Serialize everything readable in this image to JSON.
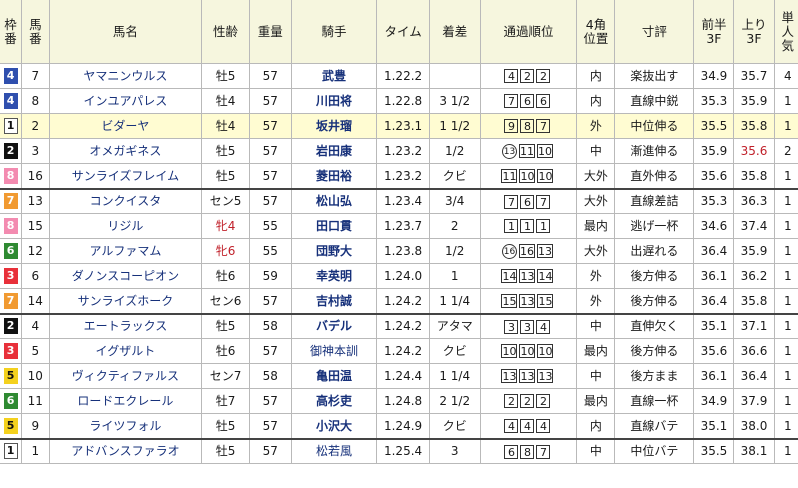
{
  "header": {
    "waku": [
      "枠",
      "番"
    ],
    "umaban": [
      "馬",
      "番"
    ],
    "name": "馬名",
    "sex_age": "性齢",
    "weight": "重量",
    "jockey": "騎手",
    "time": "タイム",
    "margin": "着差",
    "passing": "通過順位",
    "corner": [
      "4角",
      "位置"
    ],
    "comment": "寸評",
    "first3f": [
      "前半",
      "3F"
    ],
    "last3f": [
      "上り",
      "3F"
    ],
    "odds": [
      "単",
      "人",
      "気"
    ]
  },
  "rows": [
    {
      "waku": "4",
      "umaban": "7",
      "name": "ヤマニンウルス",
      "sex_age": "牡5",
      "weight": "57",
      "jockey": "武豊",
      "time": "1.22.2",
      "margin": "",
      "passing": [
        {
          "v": "4",
          "c": false
        },
        {
          "v": "2",
          "c": false
        },
        {
          "v": "2",
          "c": false
        }
      ],
      "corner": "内",
      "comment": "楽抜出す",
      "first3f": "34.9",
      "last3f": "35.7",
      "odds": "4"
    },
    {
      "waku": "4",
      "umaban": "8",
      "name": "インユアパレス",
      "sex_age": "牡4",
      "weight": "57",
      "jockey": "川田将",
      "time": "1.22.8",
      "margin": "3 1/2",
      "passing": [
        {
          "v": "7",
          "c": false
        },
        {
          "v": "6",
          "c": false
        },
        {
          "v": "6",
          "c": false
        }
      ],
      "corner": "内",
      "comment": "直線中鋭",
      "first3f": "35.3",
      "last3f": "35.9",
      "odds": "1"
    },
    {
      "waku": "1",
      "umaban": "2",
      "name": "ビダーヤ",
      "sex_age": "牡4",
      "weight": "57",
      "jockey": "坂井瑠",
      "time": "1.23.1",
      "margin": "1 1/2",
      "passing": [
        {
          "v": "9",
          "c": false
        },
        {
          "v": "8",
          "c": false
        },
        {
          "v": "7",
          "c": false
        }
      ],
      "corner": "外",
      "comment": "中位伸る",
      "first3f": "35.5",
      "last3f": "35.8",
      "odds": "1"
    },
    {
      "waku": "2",
      "umaban": "3",
      "name": "オメガギネス",
      "sex_age": "牡5",
      "weight": "57",
      "jockey": "岩田康",
      "time": "1.23.2",
      "margin": "1/2",
      "passing": [
        {
          "v": "13",
          "c": true
        },
        {
          "v": "11",
          "c": false
        },
        {
          "v": "10",
          "c": false
        }
      ],
      "corner": "中",
      "comment": "漸進伸る",
      "first3f": "35.9",
      "last3f": "35.6",
      "odds": "2"
    },
    {
      "waku": "8",
      "umaban": "16",
      "name": "サンライズフレイム",
      "sex_age": "牡5",
      "weight": "57",
      "jockey": "菱田裕",
      "time": "1.23.2",
      "margin": "クビ",
      "passing": [
        {
          "v": "11",
          "c": false
        },
        {
          "v": "10",
          "c": false
        },
        {
          "v": "10",
          "c": false
        }
      ],
      "corner": "大外",
      "comment": "直外伸る",
      "first3f": "35.6",
      "last3f": "35.8",
      "odds": "1"
    },
    {
      "waku": "7",
      "umaban": "13",
      "name": "コンクイスタ",
      "sex_age": "セン5",
      "weight": "57",
      "jockey": "松山弘",
      "time": "1.23.4",
      "margin": "3/4",
      "passing": [
        {
          "v": "7",
          "c": false
        },
        {
          "v": "6",
          "c": false
        },
        {
          "v": "7",
          "c": false
        }
      ],
      "corner": "大外",
      "comment": "直線差詰",
      "first3f": "35.3",
      "last3f": "36.3",
      "odds": "1"
    },
    {
      "waku": "8",
      "umaban": "15",
      "name": "リジル",
      "sex_age": "牝4",
      "weight": "55",
      "jockey": "田口貫",
      "time": "1.23.7",
      "margin": "2",
      "passing": [
        {
          "v": "1",
          "c": false
        },
        {
          "v": "1",
          "c": false
        },
        {
          "v": "1",
          "c": false
        }
      ],
      "corner": "最内",
      "comment": "逃げ一杯",
      "first3f": "34.6",
      "last3f": "37.4",
      "odds": "1"
    },
    {
      "waku": "6",
      "umaban": "12",
      "name": "アルファマム",
      "sex_age": "牝6",
      "weight": "55",
      "jockey": "団野大",
      "time": "1.23.8",
      "margin": "1/2",
      "passing": [
        {
          "v": "16",
          "c": true
        },
        {
          "v": "16",
          "c": false
        },
        {
          "v": "13",
          "c": false
        }
      ],
      "corner": "大外",
      "comment": "出遅れる",
      "first3f": "36.4",
      "last3f": "35.9",
      "odds": "1"
    },
    {
      "waku": "3",
      "umaban": "6",
      "name": "ダノンスコーピオン",
      "sex_age": "牡6",
      "weight": "59",
      "jockey": "幸英明",
      "time": "1.24.0",
      "margin": "1",
      "passing": [
        {
          "v": "14",
          "c": false
        },
        {
          "v": "13",
          "c": false
        },
        {
          "v": "14",
          "c": false
        }
      ],
      "corner": "外",
      "comment": "後方伸る",
      "first3f": "36.1",
      "last3f": "36.2",
      "odds": "1"
    },
    {
      "waku": "7",
      "umaban": "14",
      "name": "サンライズホーク",
      "sex_age": "セン6",
      "weight": "57",
      "jockey": "吉村誠",
      "time": "1.24.2",
      "margin": "1 1/4",
      "passing": [
        {
          "v": "15",
          "c": false
        },
        {
          "v": "13",
          "c": false
        },
        {
          "v": "15",
          "c": false
        }
      ],
      "corner": "外",
      "comment": "後方伸る",
      "first3f": "36.4",
      "last3f": "35.8",
      "odds": "1"
    },
    {
      "waku": "2",
      "umaban": "4",
      "name": "エートラックス",
      "sex_age": "牡5",
      "weight": "58",
      "jockey": "バデル",
      "time": "1.24.2",
      "margin": "アタマ",
      "passing": [
        {
          "v": "3",
          "c": false
        },
        {
          "v": "3",
          "c": false
        },
        {
          "v": "4",
          "c": false
        }
      ],
      "corner": "中",
      "comment": "直伸欠く",
      "first3f": "35.1",
      "last3f": "37.1",
      "odds": "1"
    },
    {
      "waku": "3",
      "umaban": "5",
      "name": "イグザルト",
      "sex_age": "牡6",
      "weight": "57",
      "jockey": "御神本訓",
      "time": "1.24.2",
      "margin": "クビ",
      "passing": [
        {
          "v": "10",
          "c": false
        },
        {
          "v": "10",
          "c": false
        },
        {
          "v": "10",
          "c": false
        }
      ],
      "corner": "最内",
      "comment": "後方伸る",
      "first3f": "35.6",
      "last3f": "36.6",
      "odds": "1"
    },
    {
      "waku": "5",
      "umaban": "10",
      "name": "ヴィクティファルス",
      "sex_age": "セン7",
      "weight": "58",
      "jockey": "亀田温",
      "time": "1.24.4",
      "margin": "1 1/4",
      "passing": [
        {
          "v": "13",
          "c": false
        },
        {
          "v": "13",
          "c": false
        },
        {
          "v": "13",
          "c": false
        }
      ],
      "corner": "中",
      "comment": "後方まま",
      "first3f": "36.1",
      "last3f": "36.4",
      "odds": "1"
    },
    {
      "waku": "6",
      "umaban": "11",
      "name": "ロードエクレール",
      "sex_age": "牡7",
      "weight": "57",
      "jockey": "高杉吏",
      "time": "1.24.8",
      "margin": "2 1/2",
      "passing": [
        {
          "v": "2",
          "c": false
        },
        {
          "v": "2",
          "c": false
        },
        {
          "v": "2",
          "c": false
        }
      ],
      "corner": "最内",
      "comment": "直線一杯",
      "first3f": "34.9",
      "last3f": "37.9",
      "odds": "1"
    },
    {
      "waku": "5",
      "umaban": "9",
      "name": "ライツフォル",
      "sex_age": "牡5",
      "weight": "57",
      "jockey": "小沢大",
      "time": "1.24.9",
      "margin": "クビ",
      "passing": [
        {
          "v": "4",
          "c": false
        },
        {
          "v": "4",
          "c": false
        },
        {
          "v": "4",
          "c": false
        }
      ],
      "corner": "内",
      "comment": "直線バテ",
      "first3f": "35.1",
      "last3f": "38.0",
      "odds": "1"
    },
    {
      "waku": "1",
      "umaban": "1",
      "name": "アドバンスファラオ",
      "sex_age": "牡5",
      "weight": "57",
      "jockey": "松若風",
      "time": "1.25.4",
      "margin": "3",
      "passing": [
        {
          "v": "6",
          "c": false
        },
        {
          "v": "8",
          "c": false
        },
        {
          "v": "7",
          "c": false
        }
      ],
      "corner": "中",
      "comment": "中位バテ",
      "first3f": "35.5",
      "last3f": "38.1",
      "odds": "1"
    }
  ],
  "highlight_row": 2,
  "group_separators_after": [
    4,
    9,
    14
  ],
  "bold_jockeys": [
    0,
    1,
    2,
    3,
    4,
    5,
    6,
    7,
    8,
    9,
    10,
    12,
    13,
    14
  ],
  "fillies": [
    6,
    7
  ],
  "red_last3f": [
    3
  ],
  "colors": {
    "header_bg": "#f6f6de",
    "highlight_row_bg": "#fffcd2",
    "waku": {
      "1": "#ffffff",
      "2": "#111111",
      "3": "#e8303a",
      "4": "#2f4fae",
      "5": "#f4d11e",
      "6": "#2f8a32",
      "7": "#f19a31",
      "8": "#f38bb0"
    },
    "name_text": "#16307a",
    "red_text": "#c0202a"
  }
}
